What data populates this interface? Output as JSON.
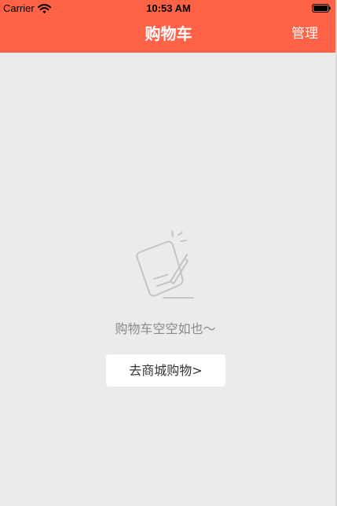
{
  "status_bar": {
    "carrier": "Carrier",
    "time": "10:53 AM",
    "wifi_icon": "wifi-icon",
    "battery_icon": "battery-icon"
  },
  "nav": {
    "title": "购物车",
    "manage_label": "管理",
    "background_color": "#fe6348"
  },
  "empty_state": {
    "illustration_icon": "empty-cart-document-icon",
    "message": "购物车空空如也～",
    "button_label": "去商城购物>"
  },
  "colors": {
    "page_background": "#ebebeb",
    "accent": "#fe6348",
    "message_text": "#8a8a8a",
    "button_background": "#ffffff"
  }
}
